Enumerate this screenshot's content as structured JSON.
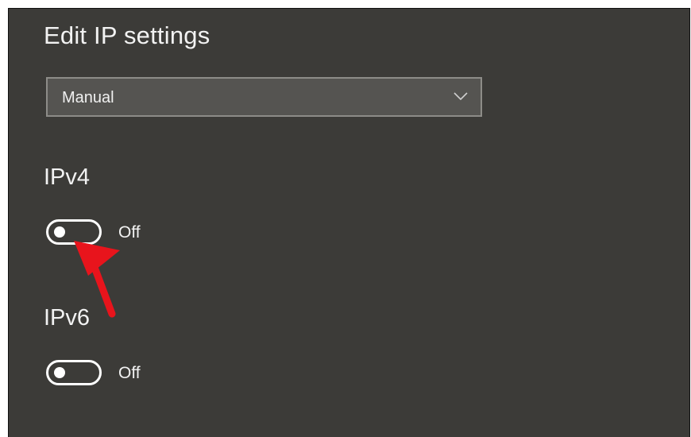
{
  "page": {
    "title": "Edit IP settings"
  },
  "dropdown": {
    "selected": "Manual",
    "icon": "chevron-down-icon"
  },
  "ipv4": {
    "label": "IPv4",
    "state_label": "Off",
    "on": false
  },
  "ipv6": {
    "label": "IPv6",
    "state_label": "Off",
    "on": false
  },
  "annotation": {
    "icon": "red-arrow-icon",
    "color": "#e8141c"
  },
  "colors": {
    "background": "#3c3b38",
    "dropdown_bg": "#555451",
    "dropdown_border": "#8d8c88",
    "text": "#f2f2f2",
    "arrow": "#e8141c"
  }
}
